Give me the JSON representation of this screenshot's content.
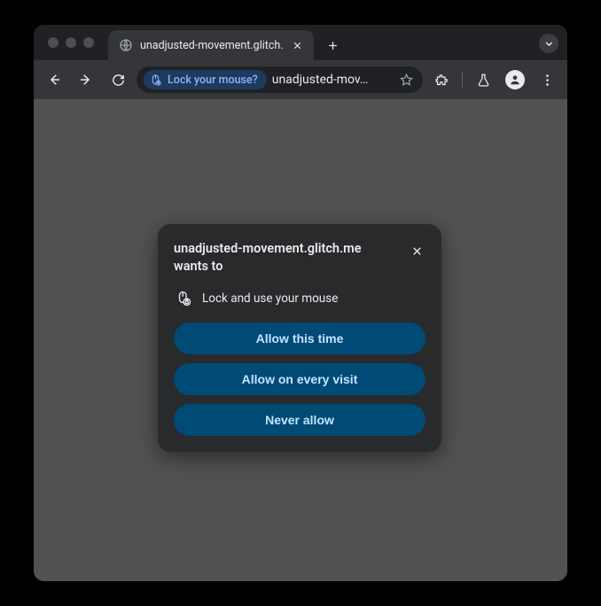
{
  "tab": {
    "title": "unadjusted-movement.glitch."
  },
  "omnibox": {
    "chip_label": "Lock your mouse?",
    "url_text": "unadjusted-mov…"
  },
  "permission_dialog": {
    "title": "unadjusted-movement.glitch.me wants to",
    "request_text": "Lock and use your mouse",
    "buttons": {
      "allow_once": "Allow this time",
      "allow_always": "Allow on every visit",
      "never": "Never allow"
    }
  }
}
